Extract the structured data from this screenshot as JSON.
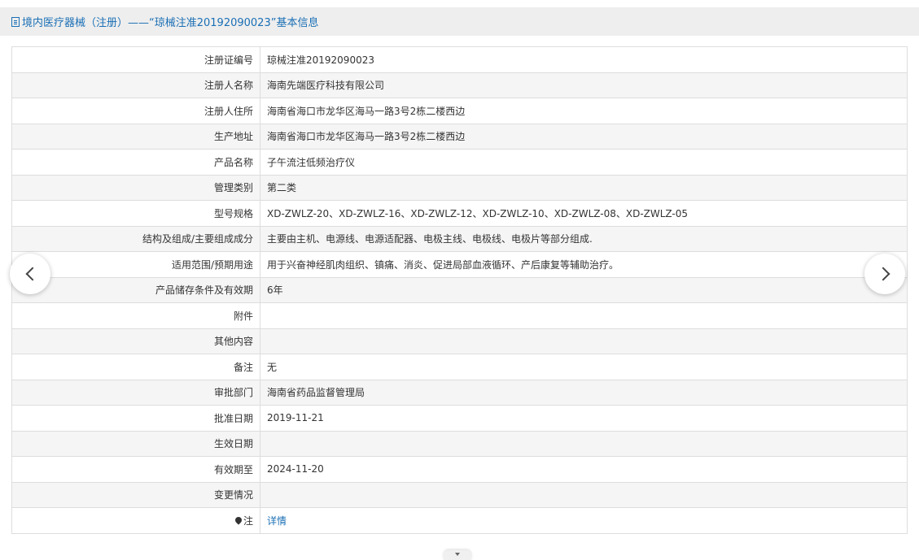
{
  "header": {
    "title": "境内医疗器械（注册）——“琼械注准20192090023”基本信息",
    "icon": "document-icon"
  },
  "rows": [
    {
      "label": "注册证编号",
      "value": "琼械注准20192090023"
    },
    {
      "label": "注册人名称",
      "value": "海南先端医疗科技有限公司"
    },
    {
      "label": "注册人住所",
      "value": "海南省海口市龙华区海马一路3号2栋二楼西边"
    },
    {
      "label": "生产地址",
      "value": "海南省海口市龙华区海马一路3号2栋二楼西边"
    },
    {
      "label": "产品名称",
      "value": "子午流注低频治疗仪"
    },
    {
      "label": "管理类别",
      "value": "第二类"
    },
    {
      "label": "型号规格",
      "value": "XD-ZWLZ-20、XD-ZWLZ-16、XD-ZWLZ-12、XD-ZWLZ-10、XD-ZWLZ-08、XD-ZWLZ-05"
    },
    {
      "label": "结构及组成/主要组成成分",
      "value": "主要由主机、电源线、电源适配器、电极主线、电极线、电极片等部分组成."
    },
    {
      "label": "适用范围/预期用途",
      "value": "用于兴奋神经肌肉组织、镇痛、消炎、促进局部血液循环、产后康复等辅助治疗。"
    },
    {
      "label": "产品储存条件及有效期",
      "value": "6年"
    },
    {
      "label": "附件",
      "value": ""
    },
    {
      "label": "其他内容",
      "value": ""
    },
    {
      "label": "备注",
      "value": "无"
    },
    {
      "label": "审批部门",
      "value": "海南省药品监督管理局"
    },
    {
      "label": "批准日期",
      "value": "2019-11-21"
    },
    {
      "label": "生效日期",
      "value": ""
    },
    {
      "label": "有效期至",
      "value": "2024-11-20"
    },
    {
      "label": "变更情况",
      "value": ""
    }
  ],
  "note_row": {
    "label": "注",
    "icon": "pin-icon",
    "link_text": "详情"
  },
  "nav": {
    "prev_icon": "chevron-left-icon",
    "next_icon": "chevron-right-icon",
    "bottom_icon": "caret-down-icon"
  },
  "colors": {
    "title_text": "#1a6fb5",
    "link": "#1a6fb5",
    "title_bar_bg": "#eeeeee",
    "row_alt_bg": "#f5f5f5",
    "border": "#dddddd"
  }
}
